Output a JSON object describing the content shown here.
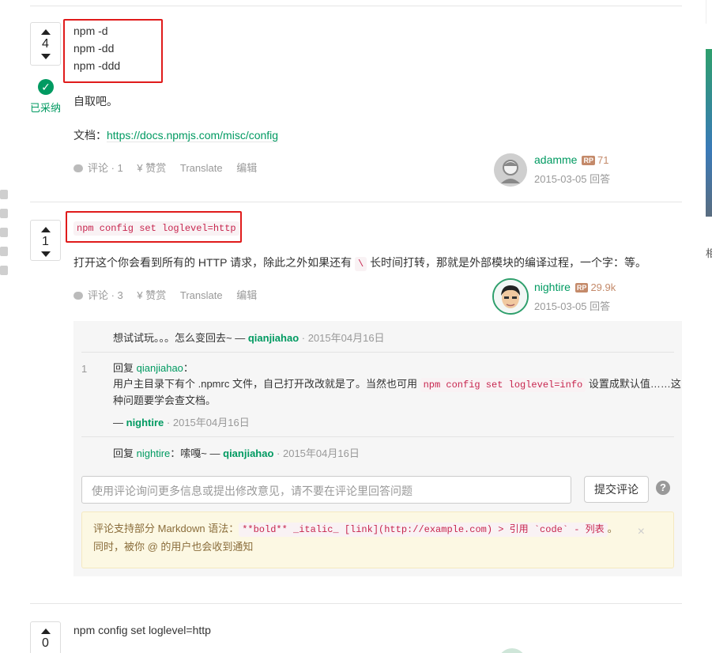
{
  "answer1": {
    "votes": "4",
    "accepted_label": "已采纳",
    "code_lines": [
      "npm -d",
      "npm -dd",
      "npm -ddd"
    ],
    "text1": "自取吧。",
    "doc_label": "文档：",
    "doc_link": "https://docs.npmjs.com/misc/config",
    "actions": {
      "comment": "评论 · 1",
      "reward": "¥ 赞赏",
      "translate": "Translate",
      "edit": "编辑"
    },
    "author": {
      "name": "adamme",
      "rp_badge": "RP",
      "rp": "71",
      "time": "2015-03-05 回答"
    }
  },
  "answer2": {
    "votes": "1",
    "code": "npm config set loglevel=http",
    "text_before": "打开这个你会看到所有的 HTTP 请求，除此之外如果还有",
    "text_code": "\\",
    "text_after": "长时间打转，那就是外部模块的编译过程，一个字：等。",
    "actions": {
      "comment": "评论 · 3",
      "reward": "¥ 赞赏",
      "translate": "Translate",
      "edit": "编辑"
    },
    "author": {
      "name": "nightire",
      "rp_badge": "RP",
      "rp": "29.9k",
      "time": "2015-03-05 回答"
    },
    "comments": [
      {
        "text": "想试试玩。。。怎么变回去~ —",
        "user": "qianjiahao",
        "time": "· 2015年04月16日"
      },
      {
        "num": "1",
        "reply_prefix": "回复",
        "reply_to": "qianjiahao",
        "colon": "：",
        "line2_before": "用户主目录下有个 .npmrc 文件，自己打开改改就是了。当然也可用",
        "line2_code": "npm config set loglevel=info",
        "line2_after": "设置成默认值……这",
        "line3": "种问题要学会查文档。",
        "dash": "—",
        "user": "nightire",
        "time": "· 2015年04月16日"
      },
      {
        "reply_prefix": "回复",
        "reply_to": "nightire",
        "text": "：嗦嘎~ —",
        "user": "qianjiahao",
        "time": "· 2015年04月16日"
      }
    ],
    "input_placeholder": "使用评论询问更多信息或提出修改意见，请不要在评论里回答问题",
    "submit_label": "提交评论",
    "help_glyph": "?",
    "md_tip": {
      "prefix": "评论支持部分 Markdown 语法：",
      "syntax": "**bold** _italic_ [link](http://example.com) > 引用 `code` - 列表",
      "suffix": "。",
      "line2": "同时，被你 @ 的用户也会收到通知",
      "close": "×"
    }
  },
  "answer3": {
    "votes": "0",
    "text": "npm config set loglevel=http"
  },
  "right_char": "相"
}
